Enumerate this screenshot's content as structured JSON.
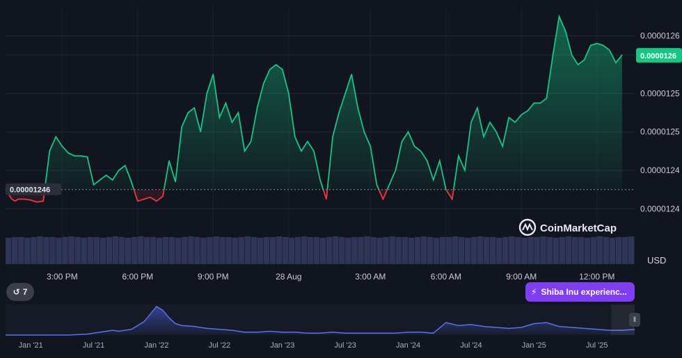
{
  "chart_data": {
    "type": "line",
    "title": "",
    "currency": "USD",
    "watermark": "CoinMarketCap",
    "baseline": 1.246e-05,
    "baseline_label": "0.00001246",
    "current_price": 1.26e-05,
    "current_price_label": "0.0000126",
    "y_ticks": [
      {
        "value": 1.262e-05,
        "label": "0.0000126"
      },
      {
        "value": 1.26e-05,
        "label": "0.0000126"
      },
      {
        "value": 1.256e-05,
        "label": "0.0000125"
      },
      {
        "value": 1.252e-05,
        "label": "0.0000125"
      },
      {
        "value": 1.248e-05,
        "label": "0.0000124"
      },
      {
        "value": 1.244e-05,
        "label": "0.0000124"
      }
    ],
    "ylim": [
      1.242e-05,
      1.265e-05
    ],
    "x_range": [
      0,
      100
    ],
    "x_ticks": [
      {
        "t": 9,
        "label": "3:00 PM"
      },
      {
        "t": 21,
        "label": "6:00 PM"
      },
      {
        "t": 33,
        "label": "9:00 PM"
      },
      {
        "t": 45,
        "label": "28 Aug"
      },
      {
        "t": 58,
        "label": "3:00 AM"
      },
      {
        "t": 70,
        "label": "6:00 AM"
      },
      {
        "t": 82,
        "label": "9:00 AM"
      },
      {
        "t": 94,
        "label": "12:00 PM"
      }
    ],
    "colors": {
      "up": "#16c784",
      "down": "#ea3943",
      "background": "#11151f",
      "volume": "#2f3556"
    },
    "series": [
      {
        "points": [
          [
            0,
            1.246e-05
          ],
          [
            1,
            1.245e-05
          ],
          [
            1.5,
            1.2448e-05
          ],
          [
            2,
            1.245e-05
          ],
          [
            3,
            1.245e-05
          ],
          [
            4,
            1.2449e-05
          ],
          [
            5,
            1.2447e-05
          ],
          [
            6,
            1.2448e-05
          ],
          [
            7,
            1.25e-05
          ],
          [
            8,
            1.2515e-05
          ],
          [
            9,
            1.2505e-05
          ],
          [
            10,
            1.2498e-05
          ],
          [
            11,
            1.2495e-05
          ],
          [
            12,
            1.2495e-05
          ],
          [
            13,
            1.2494e-05
          ],
          [
            14,
            1.2465e-05
          ],
          [
            15,
            1.247e-05
          ],
          [
            16,
            1.2475e-05
          ],
          [
            17,
            1.247e-05
          ],
          [
            18,
            1.248e-05
          ],
          [
            19,
            1.2485e-05
          ],
          [
            20,
            1.2468e-05
          ],
          [
            21,
            1.2448e-05
          ],
          [
            22,
            1.245e-05
          ],
          [
            23,
            1.2452e-05
          ],
          [
            24,
            1.2448e-05
          ],
          [
            25,
            1.2453e-05
          ],
          [
            26,
            1.249e-05
          ],
          [
            27,
            1.2468e-05
          ],
          [
            28,
            1.2525e-05
          ],
          [
            29,
            1.254e-05
          ],
          [
            30,
            1.2545e-05
          ],
          [
            31,
            1.252e-05
          ],
          [
            32,
            1.256e-05
          ],
          [
            33,
            1.258e-05
          ],
          [
            34,
            1.2535e-05
          ],
          [
            35,
            1.255e-05
          ],
          [
            36,
            1.253e-05
          ],
          [
            37,
            1.254e-05
          ],
          [
            38,
            1.25e-05
          ],
          [
            39,
            1.251e-05
          ],
          [
            40,
            1.2545e-05
          ],
          [
            41,
            1.257e-05
          ],
          [
            42,
            1.2585e-05
          ],
          [
            43,
            1.259e-05
          ],
          [
            44,
            1.2585e-05
          ],
          [
            45,
            1.256e-05
          ],
          [
            46,
            1.2515e-05
          ],
          [
            47,
            1.25e-05
          ],
          [
            48,
            1.251e-05
          ],
          [
            49,
            1.25e-05
          ],
          [
            50,
            1.247e-05
          ],
          [
            51,
            1.245e-05
          ],
          [
            52,
            1.2515e-05
          ],
          [
            53,
            1.254e-05
          ],
          [
            54,
            1.256e-05
          ],
          [
            55,
            1.258e-05
          ],
          [
            56,
            1.2545e-05
          ],
          [
            57,
            1.252e-05
          ],
          [
            58,
            1.2505e-05
          ],
          [
            59,
            1.2465e-05
          ],
          [
            60,
            1.245e-05
          ],
          [
            61,
            1.2465e-05
          ],
          [
            62,
            1.248e-05
          ],
          [
            63,
            1.251e-05
          ],
          [
            64,
            1.252e-05
          ],
          [
            65,
            1.2505e-05
          ],
          [
            66,
            1.25e-05
          ],
          [
            67,
            1.249e-05
          ],
          [
            68,
            1.247e-05
          ],
          [
            69,
            1.249e-05
          ],
          [
            70,
            1.246e-05
          ],
          [
            71,
            1.245e-05
          ],
          [
            72,
            1.2495e-05
          ],
          [
            73,
            1.248e-05
          ],
          [
            74,
            1.253e-05
          ],
          [
            75,
            1.2545e-05
          ],
          [
            76,
            1.2515e-05
          ],
          [
            77,
            1.253e-05
          ],
          [
            78,
            1.252e-05
          ],
          [
            79,
            1.2505e-05
          ],
          [
            80,
            1.2535e-05
          ],
          [
            81,
            1.253e-05
          ],
          [
            82,
            1.2538e-05
          ],
          [
            83,
            1.2542e-05
          ],
          [
            84,
            1.255e-05
          ],
          [
            85,
            1.255e-05
          ],
          [
            86,
            1.2555e-05
          ],
          [
            87,
            1.26e-05
          ],
          [
            88,
            1.264e-05
          ],
          [
            89,
            1.2625e-05
          ],
          [
            90,
            1.26e-05
          ],
          [
            91,
            1.259e-05
          ],
          [
            92,
            1.2595e-05
          ],
          [
            93,
            1.261e-05
          ],
          [
            94,
            1.2612e-05
          ],
          [
            95,
            1.261e-05
          ],
          [
            96,
            1.2605e-05
          ],
          [
            97,
            1.2592e-05
          ],
          [
            98,
            1.26e-05
          ]
        ]
      }
    ],
    "volume": [
      38,
      39,
      39,
      38,
      39,
      40,
      39,
      39,
      38,
      39,
      40,
      39,
      38,
      39,
      39,
      38,
      39,
      40,
      39,
      38,
      39,
      40,
      39,
      39,
      38,
      39,
      39,
      38,
      39,
      40,
      39,
      38,
      39,
      40,
      39,
      39,
      38,
      39,
      40,
      39,
      38,
      39,
      39,
      40,
      39,
      38,
      39,
      40,
      39,
      39,
      38,
      39,
      40,
      39,
      38,
      39,
      39,
      40,
      39,
      38,
      39,
      40,
      39,
      39,
      38,
      39,
      40,
      39,
      38,
      39,
      39,
      40,
      39,
      38,
      39,
      40,
      39,
      39,
      38,
      39,
      40,
      39,
      38,
      39,
      39,
      40,
      39,
      38,
      39,
      40,
      39,
      39,
      38,
      39,
      40,
      39,
      38,
      39,
      39,
      40
    ],
    "navigator": {
      "x_ticks": [
        {
          "t": 4,
          "label": "Jan '21"
        },
        {
          "t": 14,
          "label": "Jul '21"
        },
        {
          "t": 24,
          "label": "Jan '22"
        },
        {
          "t": 34,
          "label": "Jul '22"
        },
        {
          "t": 44,
          "label": "Jan '23"
        },
        {
          "t": 54,
          "label": "Jul '23"
        },
        {
          "t": 64,
          "label": "Jan '24"
        },
        {
          "t": 74,
          "label": "Jul '24"
        },
        {
          "t": 84,
          "label": "Jan '25"
        },
        {
          "t": 94,
          "label": "Jul '25"
        }
      ],
      "series": [
        [
          0,
          0
        ],
        [
          10,
          0
        ],
        [
          13,
          1
        ],
        [
          15,
          3
        ],
        [
          17,
          5
        ],
        [
          18,
          4
        ],
        [
          20,
          6
        ],
        [
          22,
          14
        ],
        [
          24,
          30
        ],
        [
          25,
          26
        ],
        [
          26,
          18
        ],
        [
          27,
          12
        ],
        [
          28,
          10
        ],
        [
          30,
          9
        ],
        [
          32,
          7
        ],
        [
          34,
          6
        ],
        [
          36,
          5
        ],
        [
          38,
          3
        ],
        [
          40,
          3
        ],
        [
          42,
          4
        ],
        [
          44,
          3
        ],
        [
          46,
          3
        ],
        [
          48,
          2
        ],
        [
          50,
          2
        ],
        [
          52,
          3
        ],
        [
          54,
          2
        ],
        [
          56,
          2
        ],
        [
          58,
          2
        ],
        [
          60,
          2
        ],
        [
          62,
          2
        ],
        [
          64,
          3
        ],
        [
          66,
          3
        ],
        [
          68,
          2
        ],
        [
          70,
          13
        ],
        [
          72,
          10
        ],
        [
          74,
          11
        ],
        [
          76,
          9
        ],
        [
          78,
          8
        ],
        [
          80,
          7
        ],
        [
          82,
          8
        ],
        [
          84,
          12
        ],
        [
          86,
          13
        ],
        [
          88,
          9
        ],
        [
          90,
          8
        ],
        [
          92,
          7
        ],
        [
          94,
          6
        ],
        [
          96,
          5
        ],
        [
          98,
          5
        ],
        [
          100,
          6
        ]
      ]
    }
  },
  "controls": {
    "events_count": "7",
    "event_tag_label": "Shiba Inu experienc...",
    "usd_label": "USD"
  }
}
